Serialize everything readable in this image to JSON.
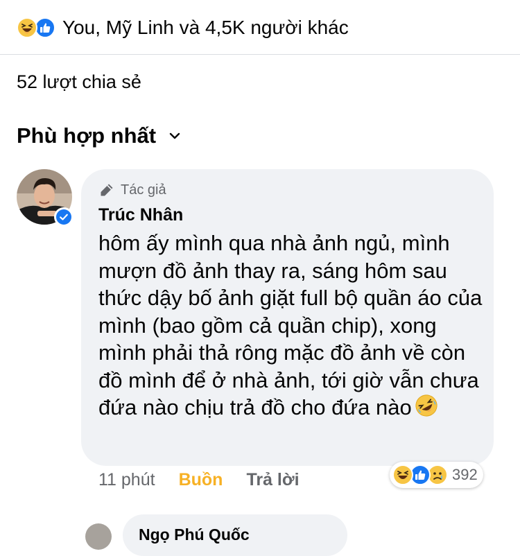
{
  "reactions_header": {
    "text": "You, Mỹ Linh và 4,5K người khác",
    "icons": [
      "haha-icon",
      "like-icon"
    ]
  },
  "shares": {
    "text": "52 lượt chia sẻ"
  },
  "sort": {
    "label": "Phù hợp nhất",
    "icon": "chevron-down-icon"
  },
  "comment": {
    "badge": "Tác giả",
    "author": "Trúc Nhân",
    "text": "hôm ấy mình qua nhà ảnh ngủ, mình mượn đồ ảnh thay ra, sáng hôm sau thức dậy bố ảnh giặt full bộ quần áo của mình (bao gồm cả quần chip), xong mình phải thả rông mặc đồ ảnh về còn đồ mình để ở nhà ảnh, tới giờ vẫn chưa đứa nào chịu trả đồ cho đứa nào",
    "trailing_emoji": "rolling-on-floor-laughing-emoji",
    "time": "11 phút",
    "my_reaction": "Buồn",
    "reply": "Trả lời",
    "reaction_count": "392",
    "reaction_icons": [
      "haha-icon",
      "like-icon",
      "sad-icon"
    ],
    "verified": true
  },
  "next_comment": {
    "author": "Ngọ Phú Quốc"
  },
  "colors": {
    "bubble": "#f0f2f5",
    "secondary_text": "#65676b",
    "sad_reaction": "#f7b125",
    "like_blue": "#1877f2",
    "emoji_yellow": "#f7c544"
  }
}
